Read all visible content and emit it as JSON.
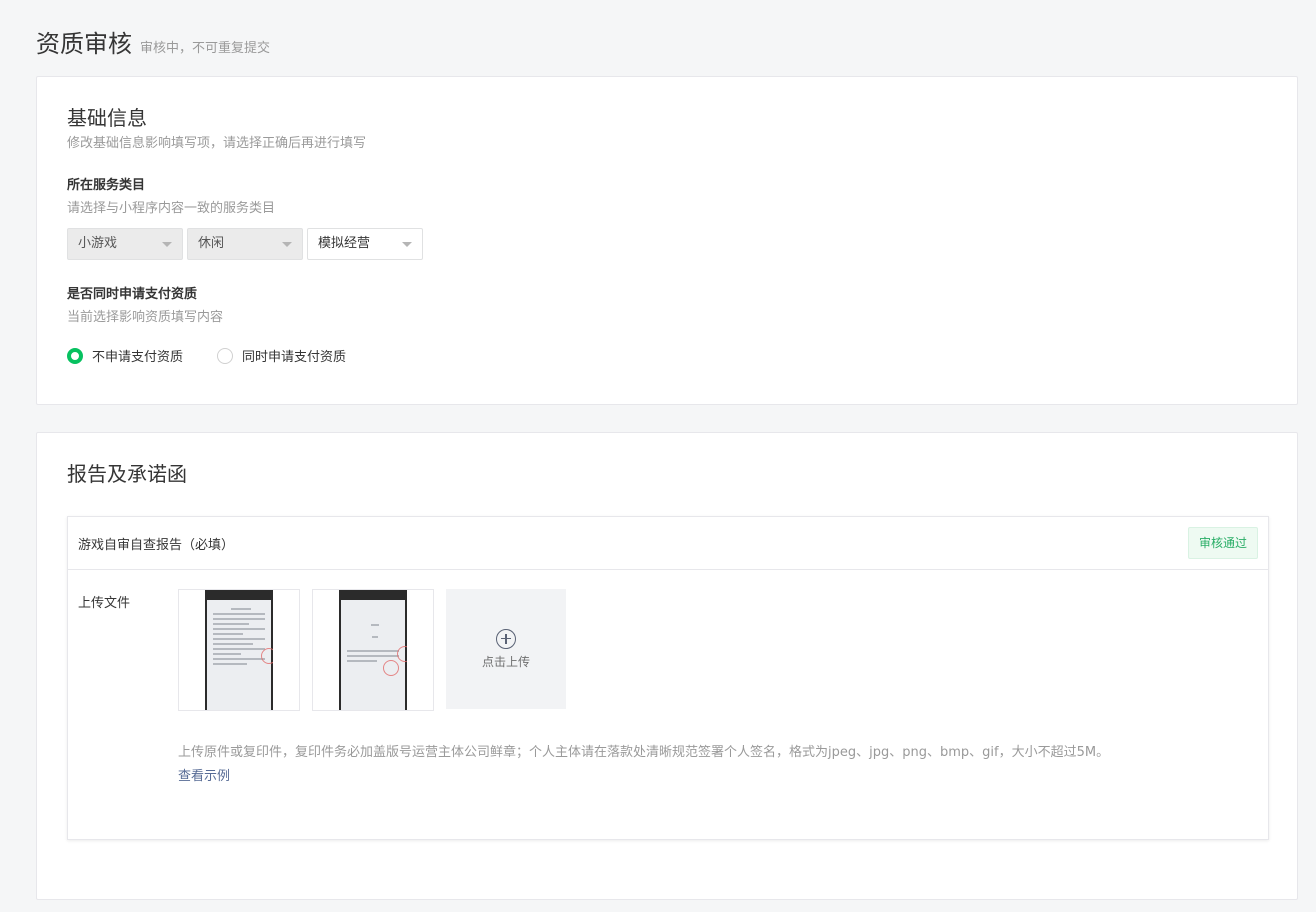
{
  "header": {
    "title": "资质审核",
    "status": "审核中，不可重复提交"
  },
  "basic": {
    "title": "基础信息",
    "desc": "修改基础信息影响填写项，请选择正确后再进行填写",
    "category": {
      "label": "所在服务类目",
      "desc": "请选择与小程序内容一致的服务类目",
      "selects": [
        "小游戏",
        "休闲",
        "模拟经营"
      ]
    },
    "payment": {
      "label": "是否同时申请支付资质",
      "desc": "当前选择影响资质填写内容",
      "options": [
        "不申请支付资质",
        "同时申请支付资质"
      ],
      "selected_index": 0
    }
  },
  "report": {
    "title": "报告及承诺函",
    "item": {
      "title": "游戏自审自查报告（必填）",
      "badge": "审核通过",
      "upload_label": "上传文件",
      "upload_button": "点击上传",
      "hint": "上传原件或复印件，复印件务必加盖版号运营主体公司鲜章；个人主体请在落款处清晰规范签署个人签名，格式为jpeg、jpg、png、bmp、gif，大小不超过5M。",
      "example_link": "查看示例"
    }
  },
  "colors": {
    "accent": "#07c160",
    "link": "#576b95",
    "badge_text": "#2aae67"
  }
}
